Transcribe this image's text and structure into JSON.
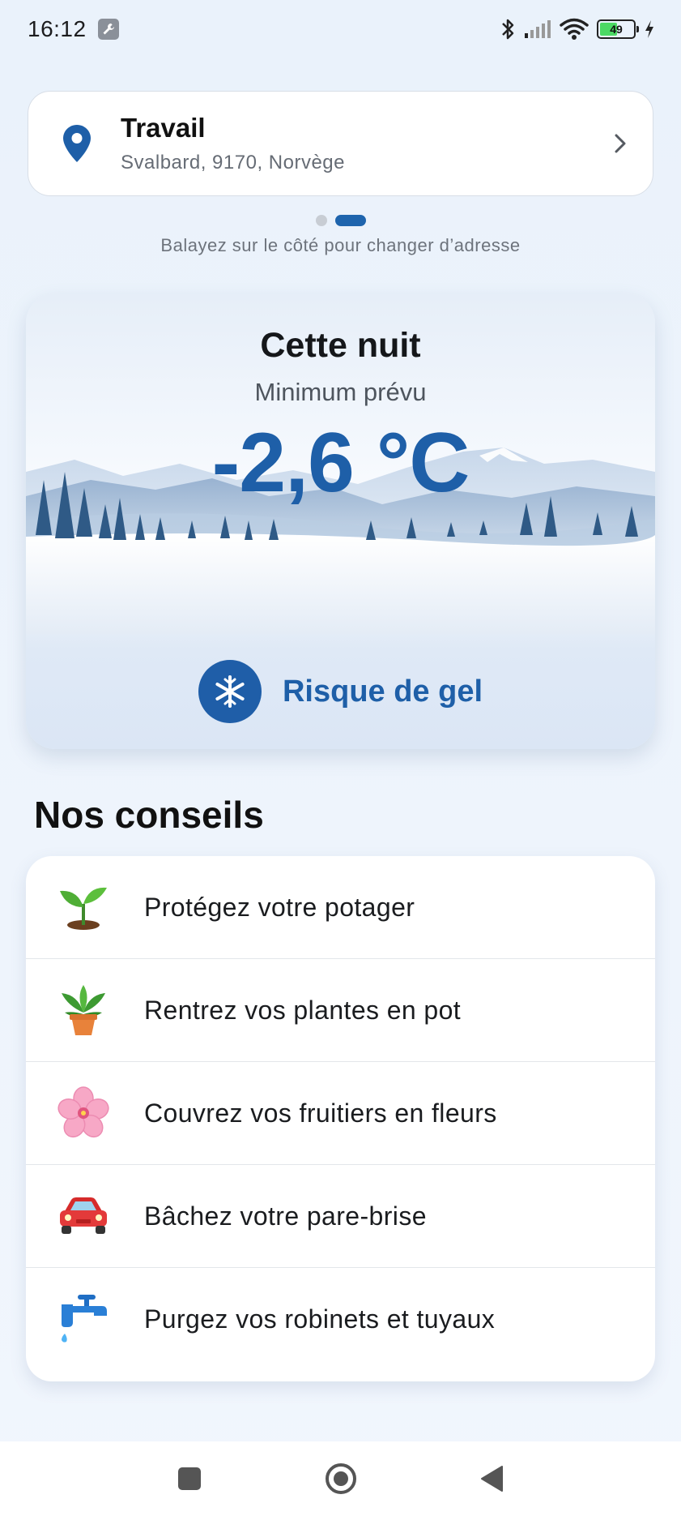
{
  "status_bar": {
    "time": "16:12",
    "battery_level": "49",
    "icons": [
      "wrench-icon",
      "bluetooth-icon",
      "signal-icon",
      "wifi-icon",
      "battery-icon",
      "charging-icon"
    ]
  },
  "address": {
    "title": "Travail",
    "subtitle": "Svalbard, 9170, Norvège",
    "pager_total": 2,
    "pager_active": 2,
    "swipe_hint": "Balayez sur le côté pour changer d’adresse"
  },
  "weather": {
    "title": "Cette nuit",
    "subtitle": "Minimum prévu",
    "temperature": "-2,6 °C",
    "alert_label": "Risque de gel",
    "alert_icon": "snowflake-icon"
  },
  "advice": {
    "heading": "Nos conseils",
    "items": [
      {
        "label": "Protégez votre potager",
        "icon": "seedling-icon"
      },
      {
        "label": "Rentrez vos plantes en pot",
        "icon": "potted-plant-icon"
      },
      {
        "label": "Couvrez vos fruitiers en fleurs",
        "icon": "blossom-icon"
      },
      {
        "label": "Bâchez votre pare-brise",
        "icon": "car-icon"
      },
      {
        "label": "Purgez vos robinets et tuyaux",
        "icon": "faucet-icon"
      }
    ]
  },
  "colors": {
    "accent": "#1e5fa8",
    "background": "#eaf2fb"
  }
}
